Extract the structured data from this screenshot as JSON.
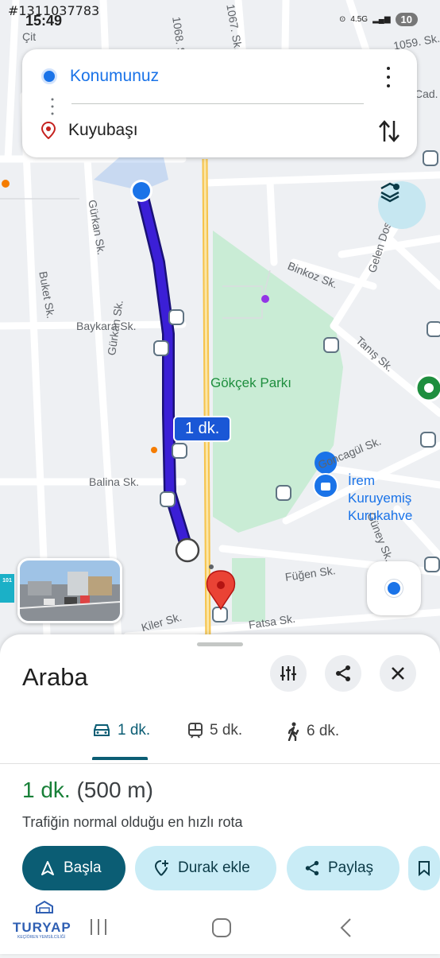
{
  "status": {
    "watermark": "#1311037783",
    "time": "15:49",
    "network": "4.5G",
    "battery": "10"
  },
  "search": {
    "origin": "Konumunuz",
    "destination": "Kuyubaşı"
  },
  "map": {
    "streets": [
      "1068. Sk.",
      "1067. Sk.",
      "Çit",
      "1059. Sk.",
      "Cad.",
      "Gürkan Sk.",
      "Buket Sk.",
      "Baykara Sk.",
      "Gürkan Sk.",
      "Binkoz Sk.",
      "Gelen Dost Sk.",
      "Tanış Sk.",
      "Goncagül Sk.",
      "Balina Sk.",
      "Füğen Sk.",
      "Güney Sk.",
      "Kiler Sk.",
      "Fatsa Sk."
    ],
    "park": "Gökçek Parkı",
    "poi": [
      "İrem Kuruyemiş",
      "Kurukahve"
    ],
    "route_time": "1 dk.",
    "route_color": "#3b1fd6",
    "park_color": "#c9ecd5"
  },
  "sheet": {
    "title": "Araba",
    "modes": [
      {
        "label": "1 dk.",
        "icon": "car-icon"
      },
      {
        "label": "5 dk.",
        "icon": "transit-icon"
      },
      {
        "label": "6 dk.",
        "icon": "walk-icon"
      }
    ],
    "duration": "1 dk.",
    "distance": "(500 m)",
    "subtitle": "Trafiğin normal olduğu en hızlı rota",
    "actions": {
      "start": "Başla",
      "add_stop": "Durak ekle",
      "share": "Paylaş"
    }
  },
  "branding": {
    "logo": "TURYAP",
    "logo_sub": "KEÇİÖREN YEMSİLCİLİĞİ"
  }
}
